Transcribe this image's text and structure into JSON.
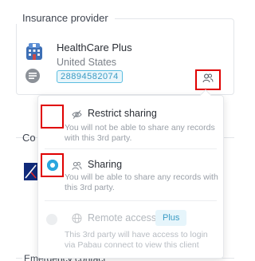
{
  "insurance": {
    "section_title": "Insurance provider",
    "provider_name": "HealthCare Plus",
    "country": "United States",
    "policy_number": "28894582074"
  },
  "card2": {
    "label_partial": "Co"
  },
  "emergency": {
    "label": "Emergency contact"
  },
  "share_menu": {
    "options": [
      {
        "title": "Restrict sharing",
        "description": "You will not be able to share any records with this 3rd party.",
        "selected": false
      },
      {
        "title": "Sharing",
        "description": "You will be able to share any records with this 3rd party.",
        "selected": true
      },
      {
        "title": "Remote access",
        "badge": "Plus",
        "description": "This 3rd party will have access to login via Pabau connect to view this client",
        "disabled": true
      }
    ]
  },
  "colors": {
    "accent": "#2aa6de",
    "highlight_box": "#e00000",
    "badge_border": "#5bbde0"
  }
}
